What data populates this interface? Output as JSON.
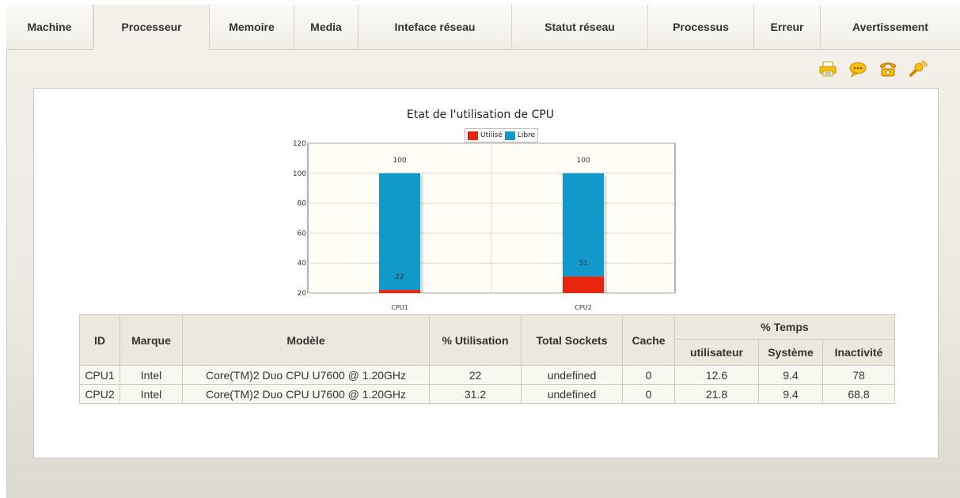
{
  "tabs": [
    {
      "label": "Machine",
      "active": false
    },
    {
      "label": "Processeur",
      "active": true
    },
    {
      "label": "Memoire",
      "active": false
    },
    {
      "label": "Media",
      "active": false
    },
    {
      "label": "Inteface réseau",
      "active": false
    },
    {
      "label": "Statut réseau",
      "active": false
    },
    {
      "label": "Processus",
      "active": false
    },
    {
      "label": "Erreur",
      "active": false
    },
    {
      "label": "Avertissement",
      "active": false
    }
  ],
  "toolbar": {
    "icons": [
      "printer-icon",
      "chat-icon",
      "phone-icon",
      "satellite-icon"
    ]
  },
  "colors": {
    "utilise": "#e8240d",
    "libre": "#1199c9",
    "plot_bg": "#fffdf6"
  },
  "chart_data": {
    "type": "bar",
    "title": "Etat de l'utilisation de CPU",
    "categories": [
      "CPU1",
      "CPU2"
    ],
    "series": [
      {
        "name": "Utilisé",
        "values": [
          22,
          31
        ]
      },
      {
        "name": "Libre",
        "values": [
          100,
          100
        ]
      }
    ],
    "ylim": [
      20,
      120
    ],
    "yticks": [
      20,
      40,
      60,
      80,
      100,
      120
    ],
    "legend": "top",
    "grid": true
  },
  "table": {
    "headers": {
      "id": "ID",
      "marque": "Marque",
      "modele": "Modèle",
      "utilisation": "% Utilisation",
      "sockets": "Total Sockets",
      "cache": "Cache",
      "temps": "% Temps",
      "utilisateur": "utilisateur",
      "systeme": "Système",
      "inactivite": "Inactivité"
    },
    "rows": [
      {
        "id": "CPU1",
        "marque": "Intel",
        "modele": "Core(TM)2 Duo CPU U7600 @ 1.20GHz",
        "utilisation": "22",
        "sockets": "undefined",
        "cache": "0",
        "utilisateur": "12.6",
        "systeme": "9.4",
        "inactivite": "78"
      },
      {
        "id": "CPU2",
        "marque": "Intel",
        "modele": "Core(TM)2 Duo CPU U7600 @ 1.20GHz",
        "utilisation": "31.2",
        "sockets": "undefined",
        "cache": "0",
        "utilisateur": "21.8",
        "systeme": "9.4",
        "inactivite": "68.8"
      }
    ]
  }
}
